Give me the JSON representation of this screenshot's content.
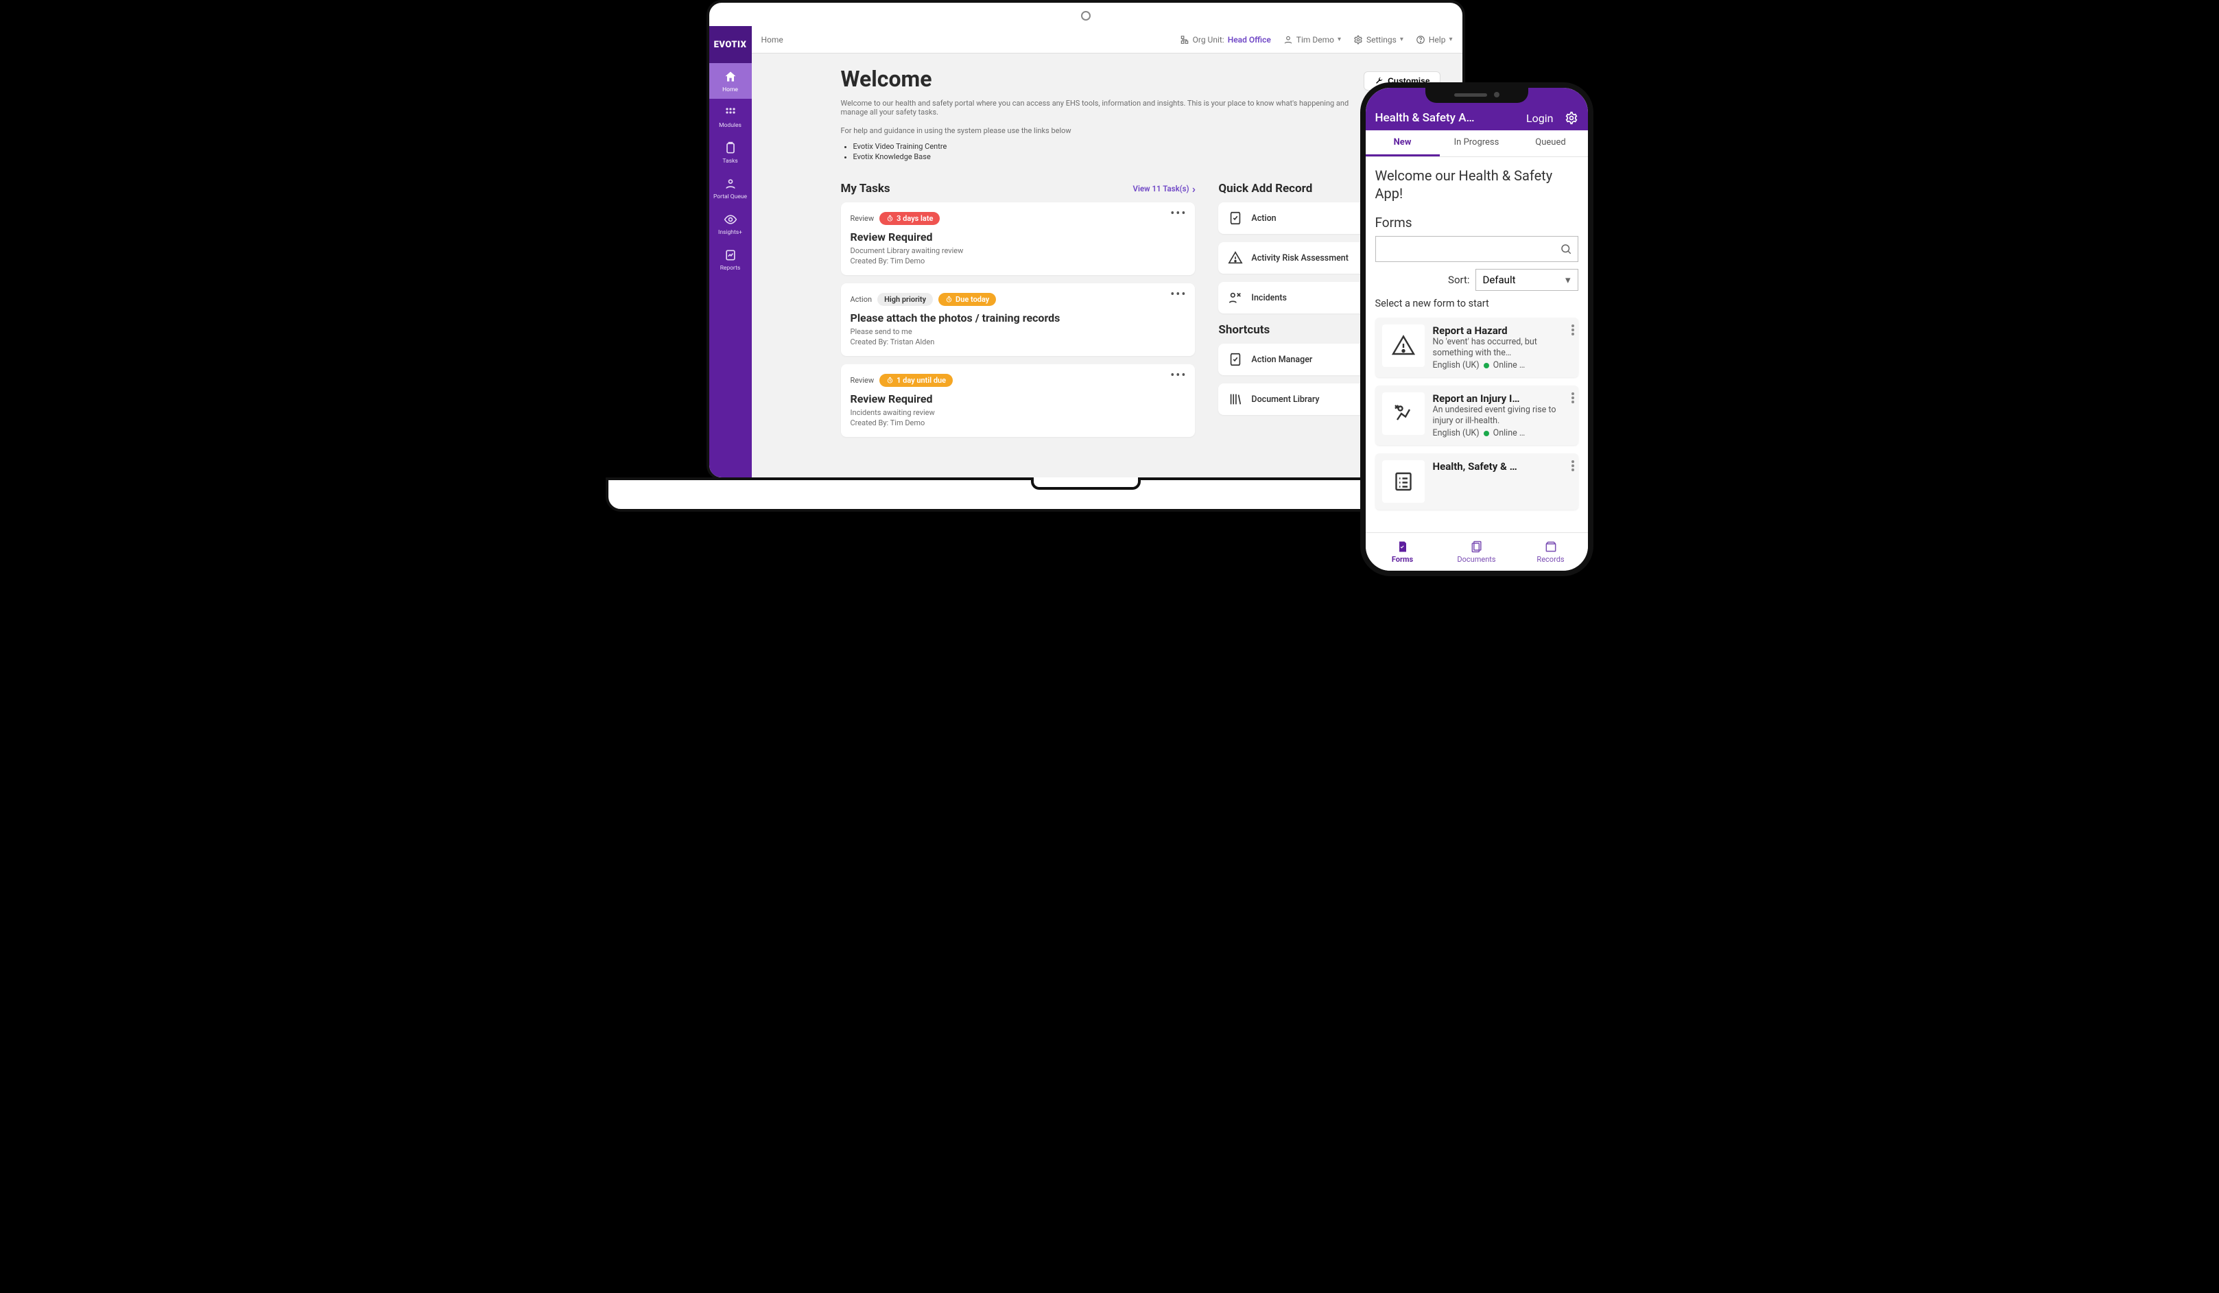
{
  "brand": "EVOTIX",
  "topbar": {
    "breadcrumb": "Home",
    "org_unit_label": "Org Unit:",
    "org_unit_value": "Head Office",
    "user": "Tim Demo",
    "settings": "Settings",
    "help": "Help"
  },
  "sidebar": [
    {
      "label": "Home"
    },
    {
      "label": "Modules"
    },
    {
      "label": "Tasks"
    },
    {
      "label": "Portal Queue"
    },
    {
      "label": "Insights+"
    },
    {
      "label": "Reports"
    }
  ],
  "welcome": {
    "title": "Welcome",
    "customise": "Customise",
    "para1": "Welcome to our health and safety portal where you can access any EHS tools, information and insights. This is your place to know what's happening and manage all your safety tasks.",
    "para2": "For help and guidance in using the system please use the links below",
    "links": [
      "Evotix Video Training Centre",
      "Evotix Knowledge Base"
    ]
  },
  "tasks": {
    "title": "My Tasks",
    "view_all": "View 11 Task(s)",
    "items": [
      {
        "type": "Review",
        "badge": {
          "style": "red",
          "label": "3 days late"
        },
        "title": "Review Required",
        "subtitle": "Document Library awaiting review",
        "created": "Created By: Tim Demo"
      },
      {
        "type": "Action",
        "priority": "High priority",
        "badge": {
          "style": "orange",
          "label": "Due today"
        },
        "title": "Please attach the photos / training records",
        "subtitle": "Please send to me",
        "created": "Created By: Tristan Alden"
      },
      {
        "type": "Review",
        "badge": {
          "style": "orange",
          "label": "1 day  until due"
        },
        "title": "Review Required",
        "subtitle": "Incidents awaiting review",
        "created": "Created By: Tim Demo"
      }
    ]
  },
  "quick_add": {
    "title": "Quick Add Record",
    "items": [
      "Action",
      "Activity Risk Assessment",
      "Incidents"
    ]
  },
  "shortcuts": {
    "title": "Shortcuts",
    "items": [
      "Action Manager",
      "Document Library"
    ]
  },
  "phone": {
    "header_title": "Health & Safety A…",
    "login": "Login",
    "tabs": [
      "New",
      "In Progress",
      "Queued"
    ],
    "welcome": "Welcome our Health & Safety App!",
    "forms_label": "Forms",
    "sort_label": "Sort:",
    "sort_value": "Default",
    "hint": "Select a new form to start",
    "forms": [
      {
        "title": "Report a Hazard",
        "desc": "No 'event' has occurred, but something with the…",
        "lang": "English (UK)",
        "online": "Online …"
      },
      {
        "title": "Report an Injury I…",
        "desc": "An undesired event giving rise to injury or ill-health.",
        "lang": "English (UK)",
        "online": "Online …"
      },
      {
        "title": "Health, Safety & …",
        "desc": "",
        "lang": "",
        "online": ""
      }
    ],
    "bottom": [
      "Forms",
      "Documents",
      "Records"
    ]
  }
}
